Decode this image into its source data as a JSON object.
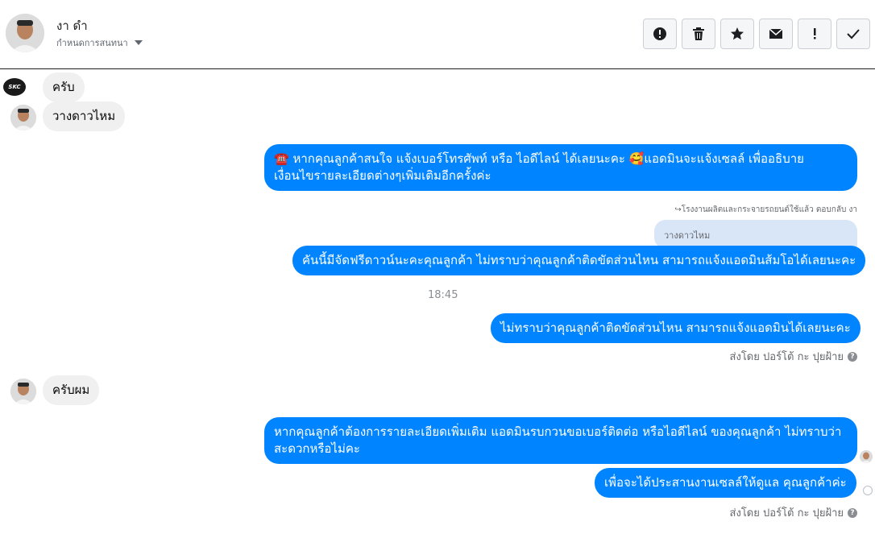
{
  "header": {
    "name": "งา ดำ",
    "subtitle": "กำหนดการสนทนา",
    "avatar_icon": "user-avatar-icon"
  },
  "toolbar": [
    {
      "icon": "alert-circle-icon",
      "name": "spam-button"
    },
    {
      "icon": "trash-icon",
      "name": "delete-button"
    },
    {
      "icon": "star-icon",
      "name": "star-button"
    },
    {
      "icon": "envelope-icon",
      "name": "mark-unread-button"
    },
    {
      "icon": "exclamation-icon",
      "name": "follow-up-button"
    },
    {
      "icon": "check-icon",
      "name": "mark-done-button"
    }
  ],
  "messages": {
    "m1": "ครับ",
    "m2": "วางดาวไหม",
    "m3_line1": "☎️ หากคุณลูกค้าสนใจ แจ้งเบอร์โทรศัพท์ หรือ ไอดีไลน์  ได้เลยนะคะ 🥰แอดมินจะแจ้งเซลล์   เพื่ออธิบาย",
    "m3_line2": "เงื่อนไขรายละเอียดต่างๆเพิ่มเติมอีกครั้งค่ะ",
    "reply_line": "โรงงานผลิตและกระจายรถยนต์ใช้แล้ว ตอบกลับ งา",
    "quote": "วางดาวไหม",
    "m4": "คันนี้มีจัดฟรีดาวน์นะคะคุณลูกค้า ไม่ทราบว่าคุณลูกค้าติดขัดส่วนไหน สามารถแจ้งแอดมินส้มโอได้เลยนะคะ",
    "time": "18:45",
    "m5": "ไม่ทราบว่าคุณลูกค้าติดขัดส่วนไหน สามารถแจ้งแอดมินได้เลยนะคะ",
    "sent_by_1": "ส่งโดย ปอร์โต้ กะ ปุยฝ้าย",
    "m6": "ครับผม",
    "m7_line1": "หากคุณลูกค้าต้องการรายละเอียดเพิ่มเติม แอดมินรบกวนขอเบอร์ติดต่อ หรือไอดีไลน์ ของคุณลูกค้า ไม่ทราบว่า",
    "m7_line2": "สะดวกหรือไม่คะ",
    "m8": "เพื่อจะได้ประสานงานเซลล์ให้ดูแล คุณลูกค้าค่ะ",
    "sent_by_2": "ส่งโดย ปอร์โต้ กะ ปุยฝ้าย",
    "help_glyph": "?"
  },
  "colors": {
    "outgoing": "#0084ff",
    "incoming": "#f0f0f0",
    "quote": "#d8e6f8"
  }
}
